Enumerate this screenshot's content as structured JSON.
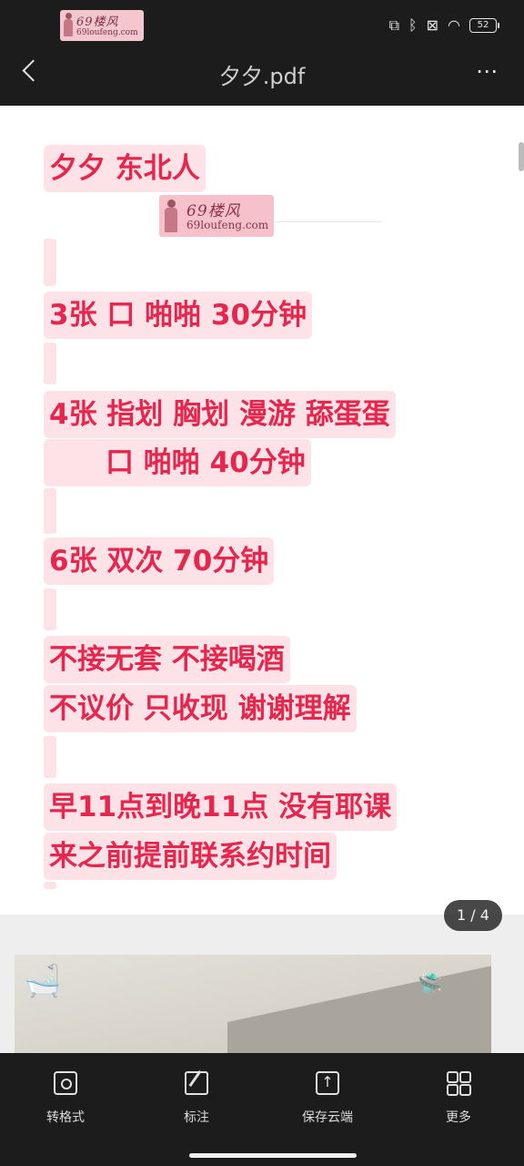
{
  "status_bar": {
    "watermark": {
      "title": "69楼风",
      "url": "69loufeng.com"
    },
    "battery": "52",
    "icons": [
      "screen-rotate-icon",
      "bluetooth-icon",
      "sim-off-icon",
      "wifi-icon"
    ]
  },
  "titlebar": {
    "title": "夕夕.pdf"
  },
  "document": {
    "lines": [
      "夕夕 东北人",
      "3张 口 啪啪 30分钟",
      "4张 指划 胸划 漫游 舔蛋蛋",
      "口 啪啪 40分钟",
      "6张 双次 70分钟",
      "不接无套 不接喝酒",
      "不议价 只收现 谢谢理解",
      "早11点到晚11点 没有耶课",
      "来之前提前联系约时间"
    ],
    "watermark": {
      "title": "69楼风",
      "url": "69loufeng.com"
    }
  },
  "page_indicator": "1 / 4",
  "toolbar": [
    {
      "label": "转格式",
      "icon": "convert-format-icon"
    },
    {
      "label": "标注",
      "icon": "annotate-icon"
    },
    {
      "label": "保存云端",
      "icon": "cloud-save-icon"
    },
    {
      "label": "更多",
      "icon": "grid-more-icon"
    }
  ]
}
